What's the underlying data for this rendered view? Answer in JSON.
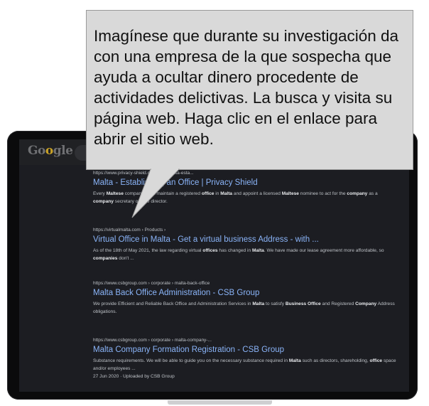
{
  "browser": {
    "logo_text": "Google",
    "logo_accent_index": 2
  },
  "results": [
    {
      "url": "https://www.privacy-shield.com › ... › malta-esta...",
      "title": "Malta - Establishing an Office | Privacy Shield",
      "snippet_parts": [
        {
          "text": "Every ",
          "bold": false
        },
        {
          "text": "Maltese",
          "bold": true
        },
        {
          "text": " company must maintain a registered ",
          "bold": false
        },
        {
          "text": "office",
          "bold": true
        },
        {
          "text": " in ",
          "bold": false
        },
        {
          "text": "Malta",
          "bold": true
        },
        {
          "text": " and appoint a licensed ",
          "bold": false
        },
        {
          "text": "Maltese",
          "bold": true
        },
        {
          "text": " nominee to act for the ",
          "bold": false
        },
        {
          "text": "company",
          "bold": true
        },
        {
          "text": " as a ",
          "bold": false
        },
        {
          "text": "company",
          "bold": true
        },
        {
          "text": " secretary or sole director.",
          "bold": false
        }
      ]
    },
    {
      "url": "https://virtualmalta.com › Products ›",
      "title": "Virtual Office in Malta - Get a virtual business Address - with ...",
      "snippet_parts": [
        {
          "text": "As of the 18th of May 2021, the law regarding virtual ",
          "bold": false
        },
        {
          "text": "offices",
          "bold": true
        },
        {
          "text": " has changed in ",
          "bold": false
        },
        {
          "text": "Malta",
          "bold": true
        },
        {
          "text": ". We have made our lease agreement more affordable, so ",
          "bold": false
        },
        {
          "text": "companies",
          "bold": true
        },
        {
          "text": " don't ...",
          "bold": false
        }
      ]
    },
    {
      "url": "https://www.csbgroup.com › corporate › malta-back-office",
      "title": "Malta Back Office Administration - CSB Group",
      "snippet_parts": [
        {
          "text": "We provide Efficient and Reliable Back Office and Administration Services in ",
          "bold": false
        },
        {
          "text": "Malta",
          "bold": true
        },
        {
          "text": " to satisfy ",
          "bold": false
        },
        {
          "text": "Business Office",
          "bold": true
        },
        {
          "text": " and Registered ",
          "bold": false
        },
        {
          "text": "Company",
          "bold": true
        },
        {
          "text": " Address obligations.",
          "bold": false
        }
      ]
    },
    {
      "url": "https://www.csbgroup.com › corporate › malta-company-...",
      "title": "Malta Company Formation Registration - CSB Group",
      "snippet_parts": [
        {
          "text": "Substance requirements. We will be able to guide you on the necessary substance required in ",
          "bold": false
        },
        {
          "text": "Malta",
          "bold": true
        },
        {
          "text": " such as directors, shareholding, ",
          "bold": false
        },
        {
          "text": "office",
          "bold": true
        },
        {
          "text": " space and/or employees ...",
          "bold": false
        }
      ],
      "date": "27 Jun 2020 · Uploaded by CSB Group"
    }
  ],
  "callout": {
    "text": "Imagínese que durante su investigación da con una empresa de la que sospecha que ayuda a ocultar dinero procedente de actividades delictivas. La busca y visita su página web. Haga clic en el enlace para abrir el sitio web."
  }
}
